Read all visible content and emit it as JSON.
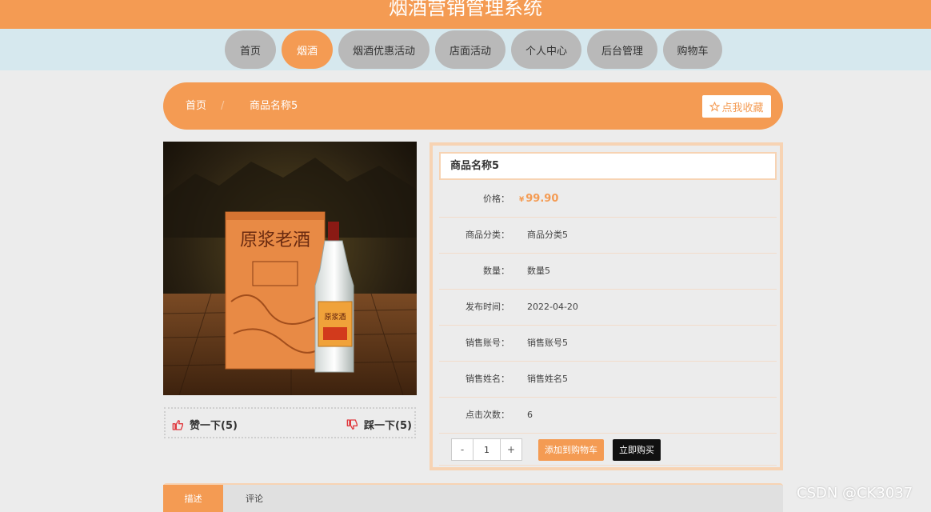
{
  "header": {
    "title": "烟酒营销管理系统"
  },
  "nav": {
    "items": [
      {
        "label": "首页",
        "active": false
      },
      {
        "label": "烟酒",
        "active": true
      },
      {
        "label": "烟酒优惠活动",
        "active": false
      },
      {
        "label": "店面活动",
        "active": false
      },
      {
        "label": "个人中心",
        "active": false
      },
      {
        "label": "后台管理",
        "active": false
      },
      {
        "label": "购物车",
        "active": false
      }
    ]
  },
  "breadcrumb": {
    "home": "首页",
    "separator": "/",
    "current": "商品名称5",
    "favorite": "点我收藏"
  },
  "product": {
    "name": "商品名称5",
    "image_text": {
      "brand": "原浆老酒",
      "bottle": "原浆酒"
    },
    "price_label": "价格：",
    "currency": "¥",
    "price": "99.90",
    "fields": [
      {
        "label": "商品分类：",
        "value": "商品分类5"
      },
      {
        "label": "数量：",
        "value": "数量5"
      },
      {
        "label": "发布时间：",
        "value": "2022-04-20"
      },
      {
        "label": "销售账号：",
        "value": "销售账号5"
      },
      {
        "label": "销售姓名：",
        "value": "销售姓名5"
      },
      {
        "label": "点击次数：",
        "value": "6"
      }
    ]
  },
  "votes": {
    "like": "赞一下(5)",
    "dislike": "踩一下(5)"
  },
  "purchase": {
    "minus": "-",
    "quantity": "1",
    "plus": "+",
    "add_to_cart": "添加到购物车",
    "buy_now": "立即购买"
  },
  "tabs": [
    {
      "label": "描述",
      "active": true
    },
    {
      "label": "评论",
      "active": false
    }
  ],
  "watermark": "CSDN @CK3037",
  "colors": {
    "accent": "#f49b53",
    "nav_band": "#d6e8ee",
    "nav_pill": "#b9b9b9",
    "like_icon": "#e0393e"
  }
}
